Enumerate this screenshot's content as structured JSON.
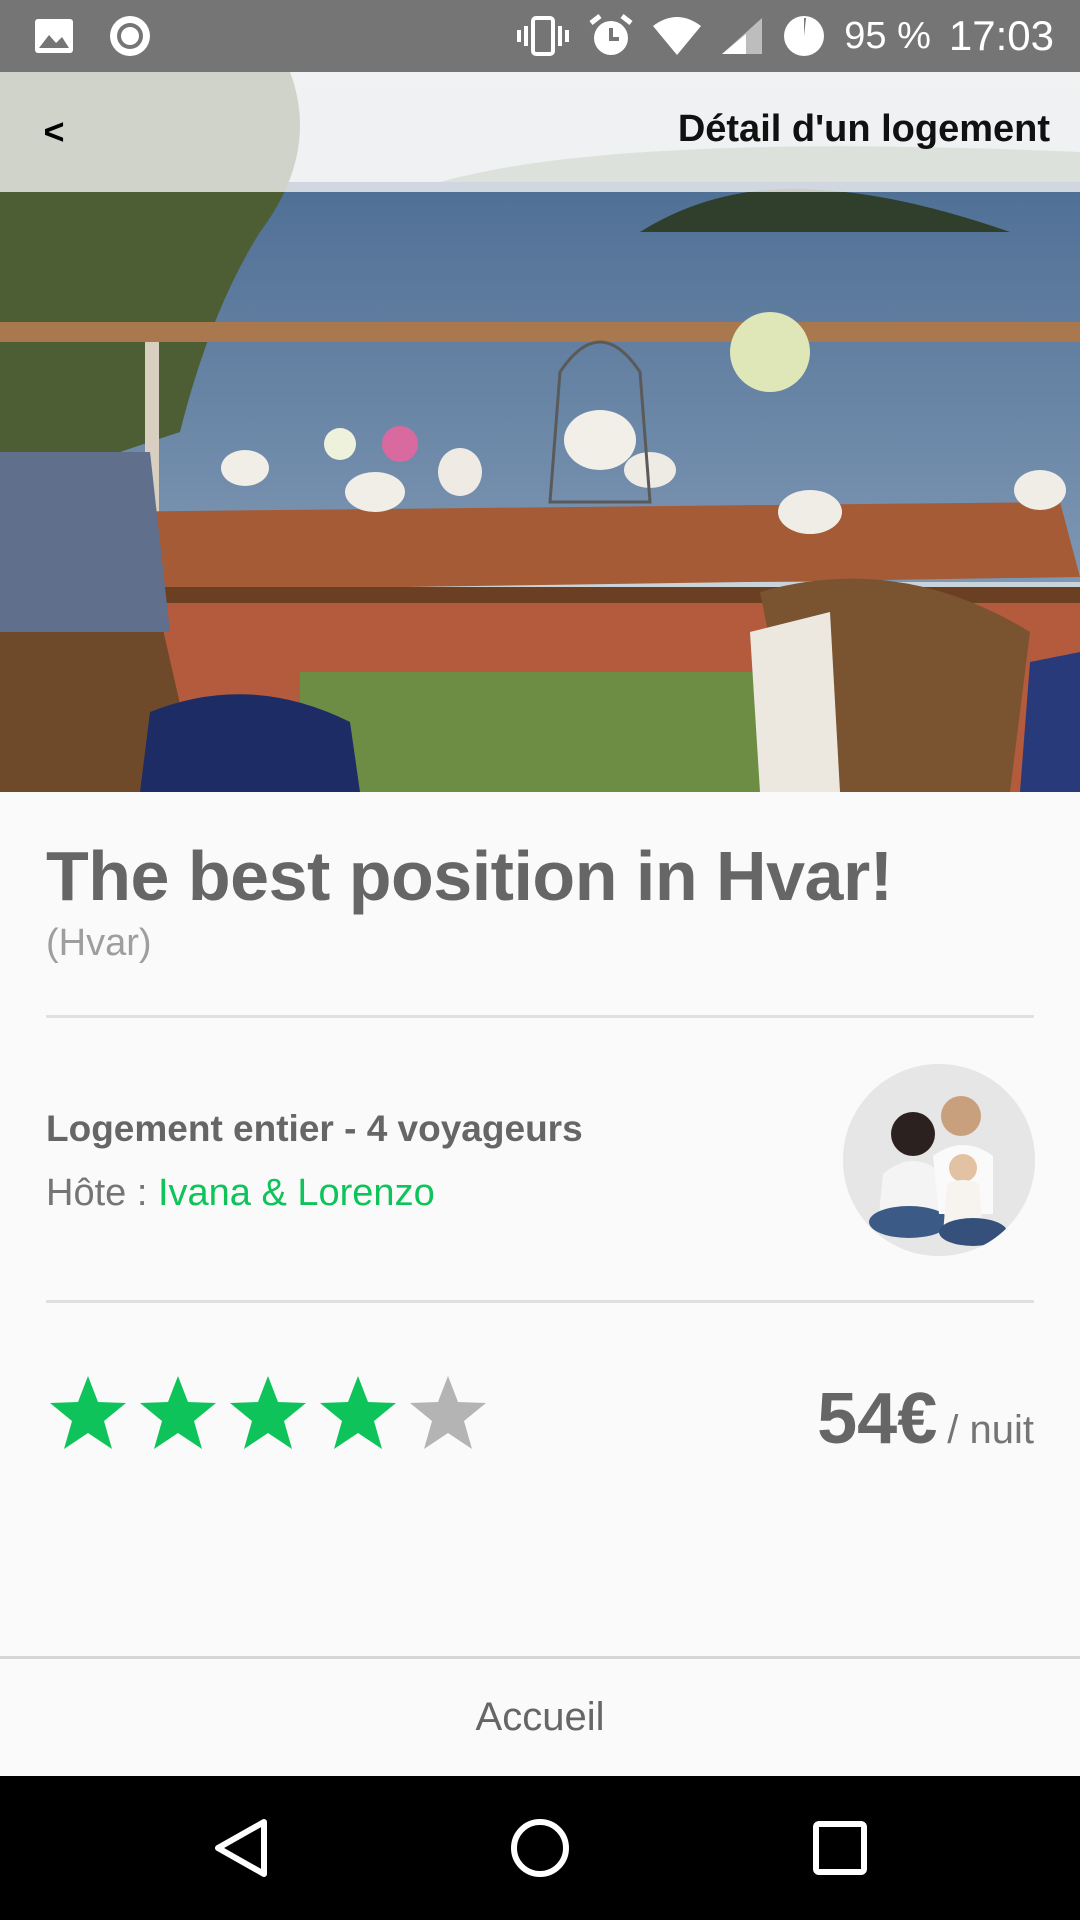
{
  "status_bar": {
    "battery": "95 %",
    "time": "17:03",
    "icons": [
      "image-icon",
      "record-icon",
      "vibrate-icon",
      "alarm-icon",
      "wifi-icon",
      "signal-icon",
      "battery-icon"
    ]
  },
  "header": {
    "back_label": "<",
    "title": "Détail d'un logement"
  },
  "listing": {
    "title": "The best position in Hvar!",
    "location": "(Hvar)",
    "type": "Logement entier - 4 voyageurs",
    "host_label": "Hôte :",
    "host_name": "Ivana & Lorenzo",
    "rating": 4,
    "rating_max": 5,
    "price": "54€",
    "price_unit": "/ nuit"
  },
  "footer": {
    "home_label": "Accueil"
  },
  "colors": {
    "accent": "#0ec45a",
    "star_off": "#b4b4b4",
    "status_bar": "#757575",
    "nav_bar": "#000000"
  }
}
